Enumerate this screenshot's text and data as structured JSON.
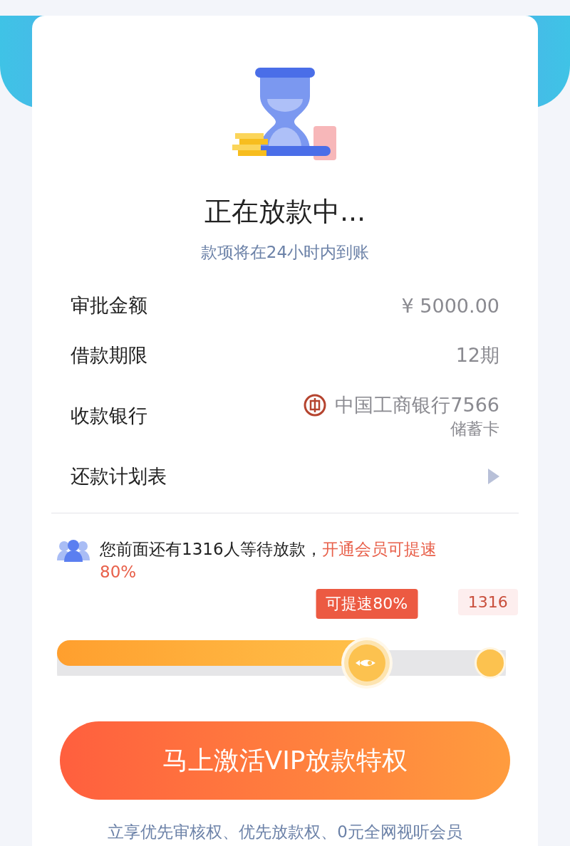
{
  "status": {
    "title": "正在放款中...",
    "subtitle": "款项将在24小时内到账"
  },
  "details": [
    {
      "kind": "plain",
      "label": "审批金额",
      "value": "¥ 5000.00"
    },
    {
      "kind": "plain",
      "label": "借款期限",
      "value": "12期"
    },
    {
      "kind": "bank",
      "label": "收款银行",
      "value": "中国工商银行7566",
      "note": "储蓄卡"
    },
    {
      "kind": "link",
      "label": "还款计划表"
    }
  ],
  "queue": {
    "text": "您前面还有1316人等待放款，",
    "highlight": "开通会员可提速80%",
    "level": 0.69,
    "speedup_tag": "可提速80%",
    "end_tag": "1316"
  },
  "action_button": "马上激活VIP放款特权",
  "footer": "立享优先审核权、优先放款权、0元全网视听会员"
}
